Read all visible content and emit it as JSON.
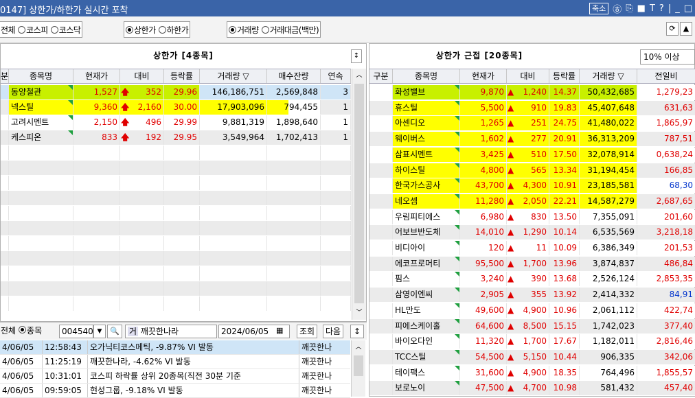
{
  "window": {
    "title": "0147] 상한가/하한가 실시간 포착",
    "shrink_btn": "축소",
    "icons": [
      "㉭",
      "⎘",
      "■",
      "T",
      "?",
      "|",
      "_",
      "□"
    ]
  },
  "toolbar": {
    "market": [
      {
        "label": "전체",
        "on": false
      },
      {
        "label": "코스피",
        "on": false
      },
      {
        "label": "코스닥",
        "on": false
      }
    ],
    "limit": [
      {
        "label": "상한가",
        "on": true
      },
      {
        "label": "하한가",
        "on": false
      }
    ],
    "sort": [
      {
        "label": "거래량",
        "on": true
      },
      {
        "label": "거래대금(백만)",
        "on": false
      }
    ],
    "refresh_icon": "⟳",
    "up_icon": "▲"
  },
  "left": {
    "title": "상한가 [4종목]",
    "columns": [
      "분",
      "종목명",
      "현재가",
      "대비",
      "등락률",
      "거래량 ▽",
      "매수잔량",
      "연속"
    ],
    "rows": [
      {
        "name": "동양철관",
        "price": "1,527",
        "arrow": "🡅",
        "chg": "352",
        "rate": "29.96",
        "vol": "146,186,751",
        "bid": "2,569,848",
        "cont": "3",
        "hl": "g",
        "sel": true
      },
      {
        "name": "넥스틸",
        "price": "9,360",
        "arrow": "🡅",
        "chg": "2,160",
        "rate": "30.00",
        "vol": "17,903,096",
        "bid": "794,455",
        "cont": "1",
        "hl": "y",
        "sel": false
      },
      {
        "name": "고려시멘트",
        "price": "2,150",
        "arrow": "🡅",
        "chg": "496",
        "rate": "29.99",
        "vol": "9,881,319",
        "bid": "1,898,640",
        "cont": "1",
        "hl": "",
        "sel": false
      },
      {
        "name": "케스피온",
        "price": "833",
        "arrow": "🡅",
        "chg": "192",
        "rate": "29.95",
        "vol": "3,549,964",
        "bid": "1,702,413",
        "cont": "1",
        "hl": "",
        "sel": false
      }
    ]
  },
  "bottom": {
    "scope_all": "전체",
    "scope_item": "종목",
    "code": "004540",
    "search_icon": "🔍",
    "gubun": "거",
    "stock": "깨끗한나라",
    "date": "2024/06/05",
    "query": "조회",
    "next": "다음",
    "calendar_icon": "📅"
  },
  "news": [
    {
      "date": "4/06/05",
      "time": "12:58:43",
      "text": "오가닉티코스메틱, -9.87% VI 발동",
      "src": "깨끗한나",
      "sel": true
    },
    {
      "date": "4/06/05",
      "time": "11:25:19",
      "text": "깨끗한나라, -4.62% VI 발동",
      "src": "깨끗한나",
      "sel": false
    },
    {
      "date": "4/06/05",
      "time": "10:31:01",
      "text": "코스피 하락률 상위 20종목(직전 30분 기준",
      "src": "깨끗한나",
      "sel": false
    },
    {
      "date": "4/06/05",
      "time": "09:59:05",
      "text": "현성그룹, -9.18% VI 발동",
      "src": "깨끗한나",
      "sel": false
    }
  ],
  "right": {
    "title": "상한가 근접 [20종목]",
    "filter": "10% 이상",
    "columns": [
      "구분",
      "종목명",
      "현재가",
      "대비",
      "등락률",
      "거래량 ▽",
      "전일비"
    ],
    "rows": [
      {
        "name": "화성밸브",
        "price": "9,870",
        "chg": "1,240",
        "rate": "14.37",
        "vol": "50,432,685",
        "prev": "1,279,23",
        "pc": "red",
        "hl": "g"
      },
      {
        "name": "휴스틸",
        "price": "5,500",
        "chg": "910",
        "rate": "19.83",
        "vol": "45,407,648",
        "prev": "631,63",
        "pc": "red",
        "hl": "y"
      },
      {
        "name": "아센디오",
        "price": "1,265",
        "chg": "251",
        "rate": "24.75",
        "vol": "41,480,022",
        "prev": "1,865,97",
        "pc": "red",
        "hl": "y"
      },
      {
        "name": "웨이버스",
        "price": "1,602",
        "chg": "277",
        "rate": "20.91",
        "vol": "36,313,209",
        "prev": "787,51",
        "pc": "red",
        "hl": "y"
      },
      {
        "name": "삼표시멘트",
        "price": "3,425",
        "chg": "510",
        "rate": "17.50",
        "vol": "32,078,914",
        "prev": "0,638,24",
        "pc": "red",
        "hl": "y"
      },
      {
        "name": "하이스틸",
        "price": "4,800",
        "chg": "565",
        "rate": "13.34",
        "vol": "31,194,454",
        "prev": "166,85",
        "pc": "red",
        "hl": "y"
      },
      {
        "name": "한국가스공사",
        "price": "43,700",
        "chg": "4,300",
        "rate": "10.91",
        "vol": "23,185,581",
        "prev": "68,30",
        "pc": "blue",
        "hl": "y"
      },
      {
        "name": "네오셈",
        "price": "11,280",
        "chg": "2,050",
        "rate": "22.21",
        "vol": "14,587,279",
        "prev": "2,687,65",
        "pc": "red",
        "hl": "y"
      },
      {
        "name": "우림피티에스",
        "price": "6,980",
        "chg": "830",
        "rate": "13.50",
        "vol": "7,355,091",
        "prev": "201,60",
        "pc": "red",
        "hl": ""
      },
      {
        "name": "어보브반도체",
        "price": "14,010",
        "chg": "1,290",
        "rate": "10.14",
        "vol": "6,535,569",
        "prev": "3,218,18",
        "pc": "red",
        "hl": ""
      },
      {
        "name": "비디아이",
        "price": "120",
        "chg": "11",
        "rate": "10.09",
        "vol": "6,386,349",
        "prev": "201,53",
        "pc": "red",
        "hl": ""
      },
      {
        "name": "에코프로머티",
        "price": "95,500",
        "chg": "1,700",
        "rate": "13.96",
        "vol": "3,874,837",
        "prev": "486,84",
        "pc": "red",
        "hl": ""
      },
      {
        "name": "핌스",
        "price": "3,240",
        "chg": "390",
        "rate": "13.68",
        "vol": "2,526,124",
        "prev": "2,853,35",
        "pc": "red",
        "hl": ""
      },
      {
        "name": "삼영이엔씨",
        "price": "2,905",
        "chg": "355",
        "rate": "13.92",
        "vol": "2,414,332",
        "prev": "84,91",
        "pc": "blue",
        "hl": ""
      },
      {
        "name": "HL만도",
        "price": "49,600",
        "chg": "4,900",
        "rate": "10.96",
        "vol": "2,061,112",
        "prev": "422,74",
        "pc": "red",
        "hl": ""
      },
      {
        "name": "피에스케이홀",
        "price": "64,600",
        "chg": "8,500",
        "rate": "15.15",
        "vol": "1,742,023",
        "prev": "377,40",
        "pc": "red",
        "hl": ""
      },
      {
        "name": "바이오다인",
        "price": "11,320",
        "chg": "1,700",
        "rate": "17.67",
        "vol": "1,182,011",
        "prev": "2,816,46",
        "pc": "red",
        "hl": ""
      },
      {
        "name": "TCC스틸",
        "price": "54,500",
        "chg": "5,150",
        "rate": "10.44",
        "vol": "906,335",
        "prev": "342,06",
        "pc": "red",
        "hl": ""
      },
      {
        "name": "테이팩스",
        "price": "31,600",
        "chg": "4,900",
        "rate": "18.35",
        "vol": "764,496",
        "prev": "1,855,57",
        "pc": "red",
        "hl": ""
      },
      {
        "name": "보로노이",
        "price": "47,500",
        "chg": "4,700",
        "rate": "10.98",
        "vol": "581,432",
        "prev": "457,40",
        "pc": "red",
        "hl": ""
      }
    ]
  }
}
